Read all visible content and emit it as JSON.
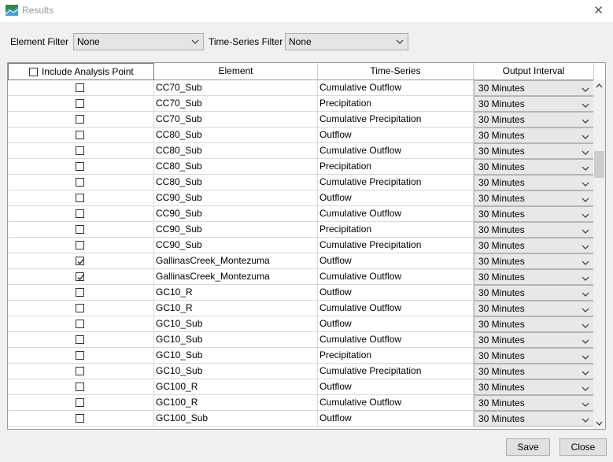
{
  "window": {
    "title": "Results"
  },
  "filters": {
    "element_label": "Element Filter",
    "element_value": "None",
    "timeseries_label": "Time-Series Filter",
    "timeseries_value": "None"
  },
  "table": {
    "headers": {
      "include": "Include Analysis Point",
      "element": "Element",
      "timeseries": "Time-Series",
      "interval": "Output Interval"
    },
    "rows": [
      {
        "checked": false,
        "element": "CC70_Sub",
        "series": "Cumulative Outflow",
        "interval": "30 Minutes"
      },
      {
        "checked": false,
        "element": "CC70_Sub",
        "series": "Precipitation",
        "interval": "30 Minutes"
      },
      {
        "checked": false,
        "element": "CC70_Sub",
        "series": "Cumulative Precipitation",
        "interval": "30 Minutes"
      },
      {
        "checked": false,
        "element": "CC80_Sub",
        "series": "Outflow",
        "interval": "30 Minutes"
      },
      {
        "checked": false,
        "element": "CC80_Sub",
        "series": "Cumulative Outflow",
        "interval": "30 Minutes"
      },
      {
        "checked": false,
        "element": "CC80_Sub",
        "series": "Precipitation",
        "interval": "30 Minutes"
      },
      {
        "checked": false,
        "element": "CC80_Sub",
        "series": "Cumulative Precipitation",
        "interval": "30 Minutes"
      },
      {
        "checked": false,
        "element": "CC90_Sub",
        "series": "Outflow",
        "interval": "30 Minutes"
      },
      {
        "checked": false,
        "element": "CC90_Sub",
        "series": "Cumulative Outflow",
        "interval": "30 Minutes"
      },
      {
        "checked": false,
        "element": "CC90_Sub",
        "series": "Precipitation",
        "interval": "30 Minutes"
      },
      {
        "checked": false,
        "element": "CC90_Sub",
        "series": "Cumulative Precipitation",
        "interval": "30 Minutes"
      },
      {
        "checked": true,
        "element": "GallinasCreek_Montezuma",
        "series": "Outflow",
        "interval": "30 Minutes"
      },
      {
        "checked": true,
        "element": "GallinasCreek_Montezuma",
        "series": "Cumulative Outflow",
        "interval": "30 Minutes"
      },
      {
        "checked": false,
        "element": "GC10_R",
        "series": "Outflow",
        "interval": "30 Minutes"
      },
      {
        "checked": false,
        "element": "GC10_R",
        "series": "Cumulative Outflow",
        "interval": "30 Minutes"
      },
      {
        "checked": false,
        "element": "GC10_Sub",
        "series": "Outflow",
        "interval": "30 Minutes"
      },
      {
        "checked": false,
        "element": "GC10_Sub",
        "series": "Cumulative Outflow",
        "interval": "30 Minutes"
      },
      {
        "checked": false,
        "element": "GC10_Sub",
        "series": "Precipitation",
        "interval": "30 Minutes"
      },
      {
        "checked": false,
        "element": "GC10_Sub",
        "series": "Cumulative Precipitation",
        "interval": "30 Minutes"
      },
      {
        "checked": false,
        "element": "GC100_R",
        "series": "Outflow",
        "interval": "30 Minutes"
      },
      {
        "checked": false,
        "element": "GC100_R",
        "series": "Cumulative Outflow",
        "interval": "30 Minutes"
      },
      {
        "checked": false,
        "element": "GC100_Sub",
        "series": "Outflow",
        "interval": "30 Minutes"
      }
    ]
  },
  "buttons": {
    "save": "Save",
    "close": "Close"
  },
  "icons": {
    "app": "results-app-icon",
    "close": "close-icon",
    "dropdown": "chevron-down-icon",
    "scroll_up": "scroll-up-icon",
    "scroll_down": "scroll-down-icon",
    "check": "check-icon"
  }
}
